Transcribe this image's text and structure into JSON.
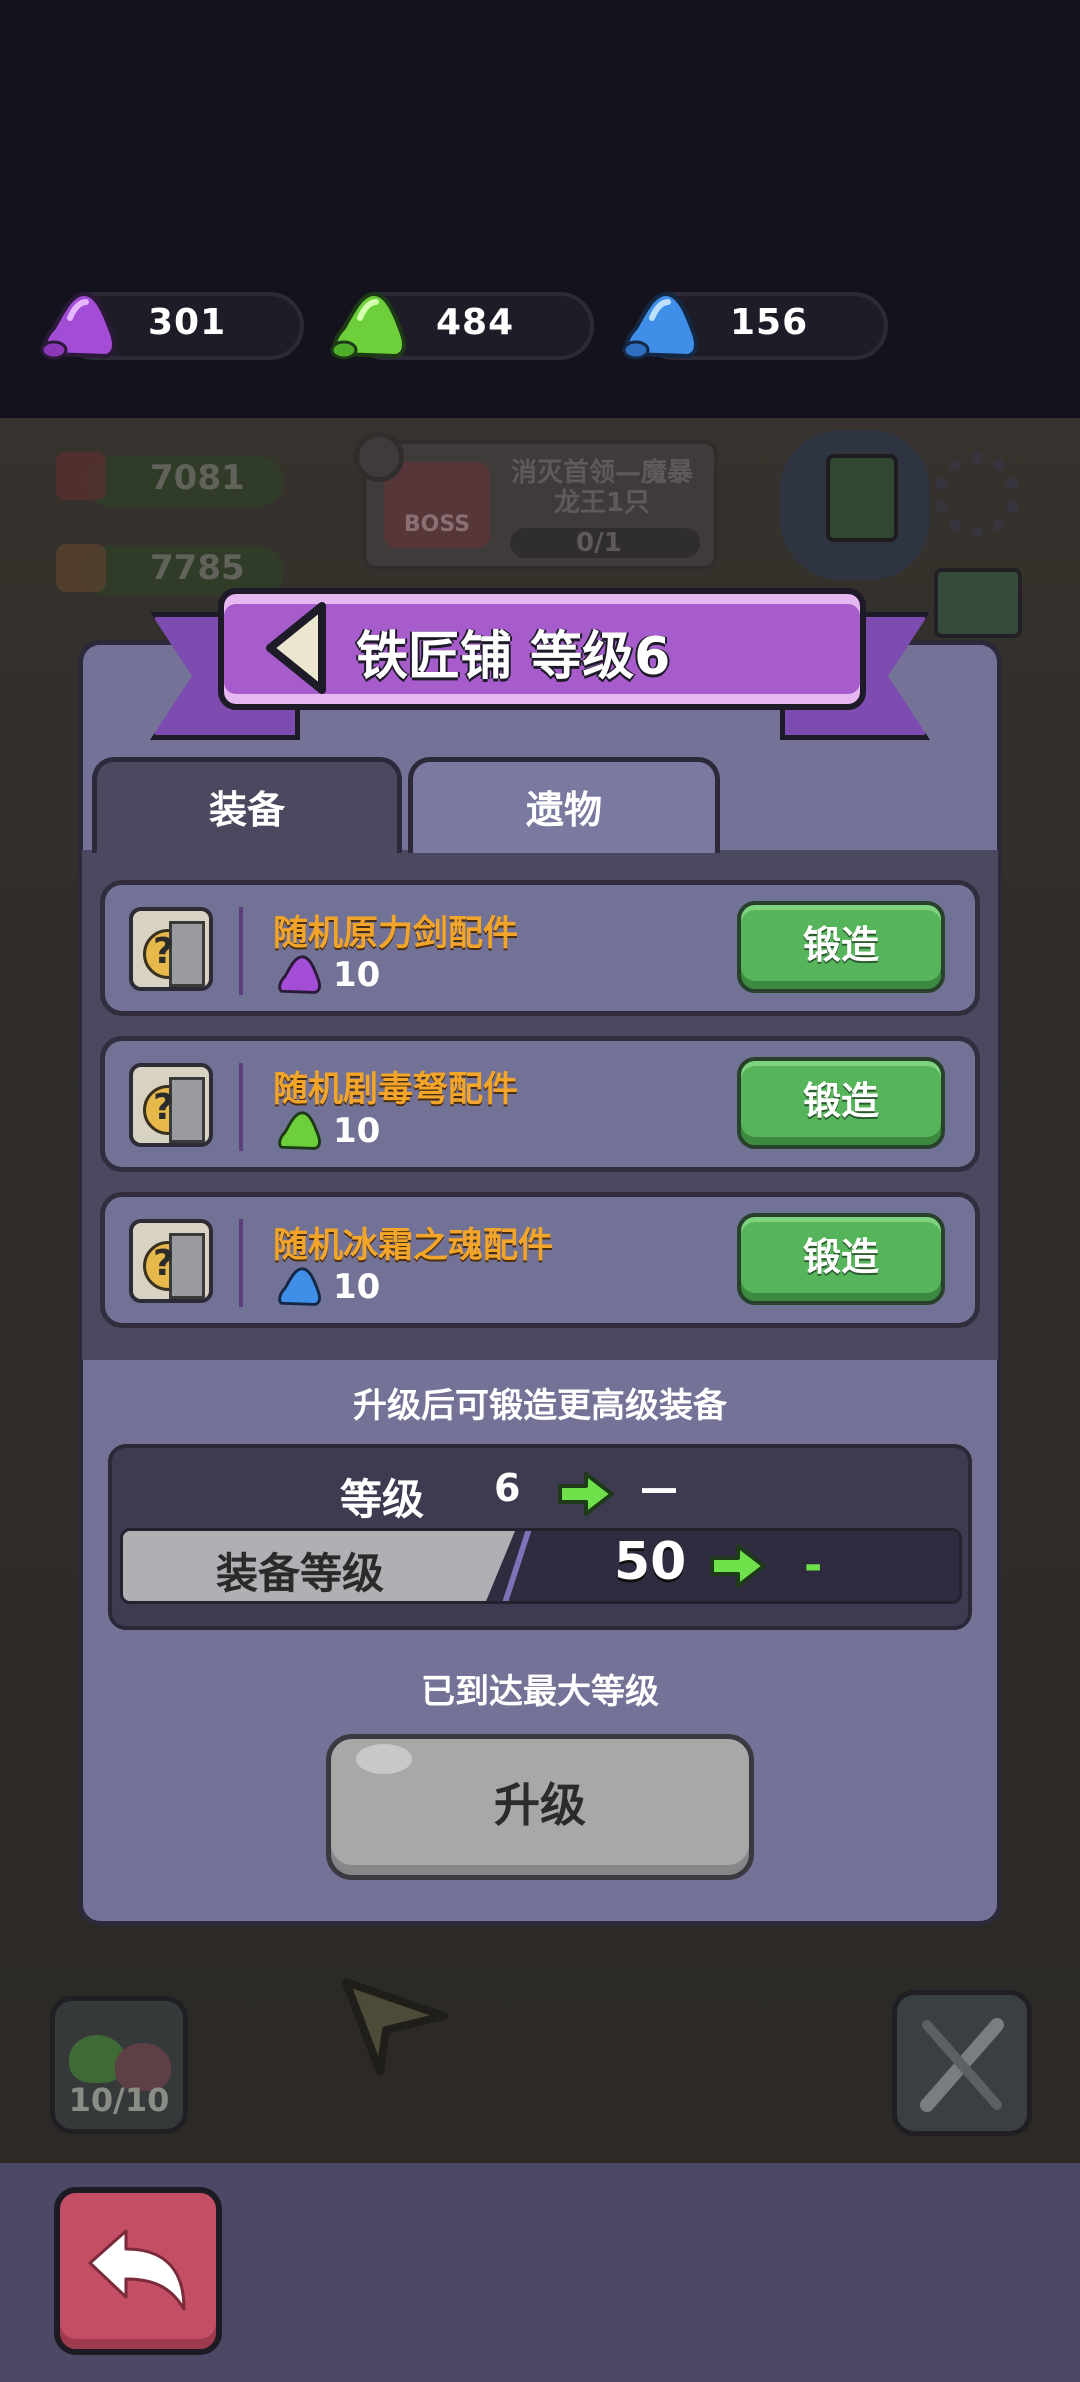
{
  "resources": [
    {
      "icon": "purple-slime-icon",
      "value": "301",
      "color": "#a34cd6"
    },
    {
      "icon": "green-slime-icon",
      "value": "484",
      "color": "#6dcf3a"
    },
    {
      "icon": "blue-slime-icon",
      "value": "156",
      "color": "#3f8ee8"
    }
  ],
  "background": {
    "stat1": "7081",
    "stat2": "7785",
    "boss_label": "BOSS",
    "quest_text": "消灭首领—魔暴龙王1只",
    "quest_progress": "0/1",
    "slime_count": "10/10"
  },
  "header": {
    "title": "铁匠铺 等级6"
  },
  "tabs": [
    {
      "label": "装备",
      "active": true
    },
    {
      "label": "遗物",
      "active": false
    }
  ],
  "forge_items": [
    {
      "name": "随机原力剑配件",
      "cost": "10",
      "cost_icon": "purple-slime-icon",
      "button": "锻造"
    },
    {
      "name": "随机剧毒弩配件",
      "cost": "10",
      "cost_icon": "green-slime-icon",
      "button": "锻造"
    },
    {
      "name": "随机冰霜之魂配件",
      "cost": "10",
      "cost_icon": "blue-slime-icon",
      "button": "锻造"
    }
  ],
  "upgrade_hint": "升级后可锻造更高级装备",
  "stats": {
    "level_label": "等级",
    "level_current": "6",
    "level_next": "—",
    "equip_label": "装备等级",
    "equip_current": "50",
    "equip_next": "-"
  },
  "max_level_text": "已到达最大等级",
  "upgrade_button": "升级"
}
